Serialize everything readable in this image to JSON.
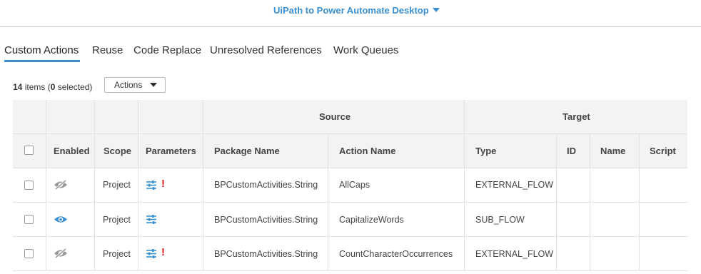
{
  "header": {
    "conversion_title": "UiPath to Power Automate Desktop"
  },
  "tabs": [
    {
      "label": "Custom Actions"
    },
    {
      "label": "Reuse"
    },
    {
      "label": "Code Replace"
    },
    {
      "label": "Unresolved References"
    },
    {
      "label": "Work Queues"
    }
  ],
  "toolbar": {
    "item_count": "14",
    "items_label": "items (",
    "selected_count": "0",
    "selected_label": "selected)",
    "actions_label": "Actions"
  },
  "table": {
    "group_headers": {
      "source": "Source",
      "target": "Target"
    },
    "columns": {
      "enabled": "Enabled",
      "scope": "Scope",
      "parameters": "Parameters",
      "package_name": "Package Name",
      "action_name": "Action Name",
      "type": "Type",
      "id": "ID",
      "name": "Name",
      "script": "Script"
    },
    "rows": [
      {
        "enabled_icon": "eye-slash-icon",
        "scope": "Project",
        "parameters_icon": "sliders-icon",
        "warning": "!",
        "package_name": "BPCustomActivities.String",
        "action_name": "AllCaps",
        "type": "EXTERNAL_FLOW",
        "id": "",
        "name": "",
        "script": ""
      },
      {
        "enabled_icon": "eye-icon",
        "scope": "Project",
        "parameters_icon": "sliders-icon",
        "warning": "",
        "package_name": "BPCustomActivities.String",
        "action_name": "CapitalizeWords",
        "type": "SUB_FLOW",
        "id": "",
        "name": "",
        "script": ""
      },
      {
        "enabled_icon": "eye-slash-icon",
        "scope": "Project",
        "parameters_icon": "sliders-icon",
        "warning": "!",
        "package_name": "BPCustomActivities.String",
        "action_name": "CountCharacterOccurrences",
        "type": "EXTERNAL_FLOW",
        "id": "",
        "name": "",
        "script": ""
      }
    ]
  },
  "colors": {
    "accent": "#3a8fd0",
    "warning": "#e02020",
    "disabled_icon": "#9a9a9a"
  }
}
